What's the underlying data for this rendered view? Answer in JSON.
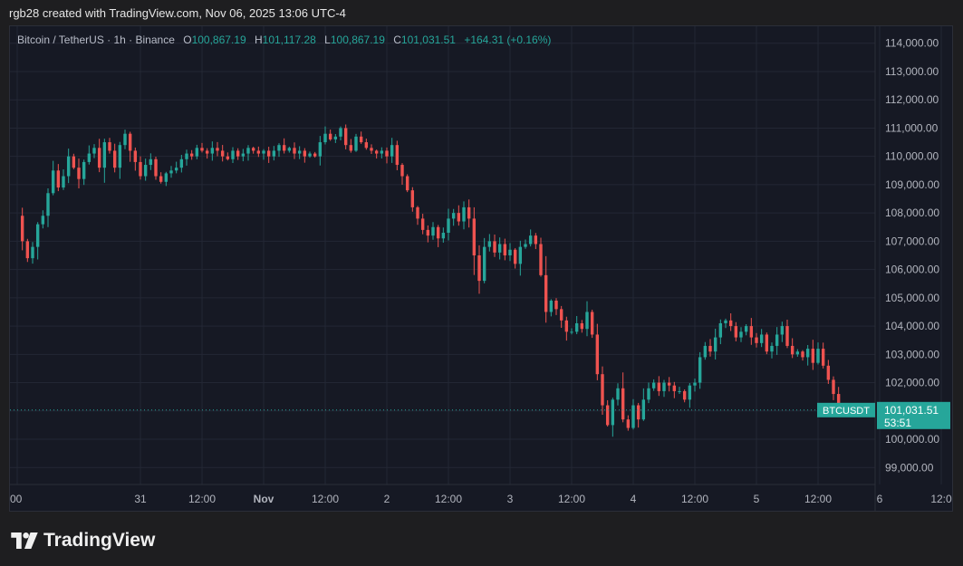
{
  "header": {
    "credit": "rgb28 created with TradingView.com, Nov 06, 2025 13:06 UTC-4"
  },
  "legend": {
    "symbol": "Bitcoin / TetherUS · 1h · Binance",
    "o_key": "O",
    "o_val": "100,867.19",
    "h_key": "H",
    "h_val": "101,117.28",
    "l_key": "L",
    "l_val": "100,867.19",
    "c_key": "C",
    "c_val": "101,031.51",
    "change": "+164.31 (+0.16%)"
  },
  "price_tag": {
    "label": "BTCUSDT",
    "price": "101,031.51",
    "countdown": "53:51"
  },
  "footer": {
    "brand": "TradingView"
  },
  "colors": {
    "up": "#26a69a",
    "down": "#ef5350",
    "background": "#161924",
    "grid": "#232734",
    "axis_text": "#b2b5be"
  },
  "chart_data": {
    "type": "candlestick",
    "symbol": "BTCUSDT",
    "interval": "1h",
    "ylim": [
      98400,
      114600
    ],
    "y_ticks": [
      "114,000.00",
      "113,000.00",
      "112,000.00",
      "111,000.00",
      "110,000.00",
      "109,000.00",
      "108,000.00",
      "107,000.00",
      "106,000.00",
      "105,000.00",
      "104,000.00",
      "103,000.00",
      "102,000.00",
      "100,000.00",
      "99,000.00"
    ],
    "y_tick_values": [
      114000,
      113000,
      112000,
      111000,
      110000,
      109000,
      108000,
      107000,
      106000,
      105000,
      104000,
      103000,
      102000,
      100000,
      99000
    ],
    "x_ticks": [
      "00",
      "31",
      "12:00",
      "Nov",
      "12:00",
      "2",
      "12:00",
      "3",
      "12:00",
      "4",
      "12:00",
      "5",
      "12:00",
      "6",
      "12:0"
    ],
    "x_tick_hours": [
      0,
      24,
      36,
      48,
      60,
      72,
      84,
      96,
      108,
      120,
      132,
      144,
      156,
      168,
      180
    ],
    "x_range_hours": [
      0,
      181
    ],
    "last_price": 101031.51,
    "grid": true,
    "anchors": [
      [
        0,
        107900
      ],
      [
        1,
        107000
      ],
      [
        2,
        106400
      ],
      [
        3,
        106800
      ],
      [
        4,
        107600
      ],
      [
        5,
        107900
      ],
      [
        6,
        108700
      ],
      [
        7,
        109500
      ],
      [
        8,
        108900
      ],
      [
        9,
        109300
      ],
      [
        10,
        110000
      ],
      [
        11,
        109600
      ],
      [
        12,
        109200
      ],
      [
        13,
        109800
      ],
      [
        14,
        110100
      ],
      [
        15,
        110300
      ],
      [
        16,
        109600
      ],
      [
        17,
        110500
      ],
      [
        18,
        110200
      ],
      [
        19,
        109600
      ],
      [
        20,
        110400
      ],
      [
        21,
        110800
      ],
      [
        22,
        110200
      ],
      [
        23,
        109800
      ],
      [
        24,
        109300
      ],
      [
        25,
        109700
      ],
      [
        26,
        109900
      ],
      [
        27,
        109300
      ],
      [
        28,
        109100
      ],
      [
        29,
        109400
      ],
      [
        30,
        109500
      ],
      [
        31,
        109600
      ],
      [
        32,
        109900
      ],
      [
        33,
        110100
      ],
      [
        34,
        110000
      ],
      [
        35,
        110300
      ],
      [
        36,
        110200
      ],
      [
        37,
        110100
      ],
      [
        38,
        110300
      ],
      [
        39,
        110200
      ],
      [
        40,
        110000
      ],
      [
        41,
        109900
      ],
      [
        42,
        110200
      ],
      [
        43,
        110000
      ],
      [
        44,
        110100
      ],
      [
        45,
        110300
      ],
      [
        46,
        110200
      ],
      [
        47,
        110100
      ],
      [
        48,
        110200
      ],
      [
        49,
        110000
      ],
      [
        50,
        110200
      ],
      [
        51,
        110400
      ],
      [
        52,
        110200
      ],
      [
        53,
        110300
      ],
      [
        54,
        110100
      ],
      [
        55,
        110200
      ],
      [
        56,
        110000
      ],
      [
        57,
        110100
      ],
      [
        58,
        110000
      ],
      [
        59,
        110500
      ],
      [
        60,
        110800
      ],
      [
        61,
        110600
      ],
      [
        62,
        110700
      ],
      [
        63,
        111000
      ],
      [
        64,
        110400
      ],
      [
        65,
        110200
      ],
      [
        66,
        110700
      ],
      [
        67,
        110500
      ],
      [
        68,
        110300
      ],
      [
        69,
        110200
      ],
      [
        70,
        110100
      ],
      [
        71,
        110200
      ],
      [
        72,
        110000
      ],
      [
        73,
        110400
      ],
      [
        74,
        109700
      ],
      [
        75,
        109300
      ],
      [
        76,
        108800
      ],
      [
        77,
        108200
      ],
      [
        78,
        107800
      ],
      [
        79,
        107400
      ],
      [
        80,
        107200
      ],
      [
        81,
        107500
      ],
      [
        82,
        107100
      ],
      [
        83,
        107300
      ],
      [
        84,
        107800
      ],
      [
        85,
        108000
      ],
      [
        86,
        107700
      ],
      [
        87,
        108200
      ],
      [
        88,
        107800
      ],
      [
        89,
        106500
      ],
      [
        90,
        105600
      ],
      [
        91,
        106800
      ],
      [
        92,
        107000
      ],
      [
        93,
        106600
      ],
      [
        94,
        106900
      ],
      [
        95,
        106500
      ],
      [
        96,
        106700
      ],
      [
        97,
        106200
      ],
      [
        98,
        106800
      ],
      [
        99,
        106900
      ],
      [
        100,
        107200
      ],
      [
        101,
        106900
      ],
      [
        102,
        105800
      ],
      [
        103,
        104500
      ],
      [
        104,
        104900
      ],
      [
        105,
        104600
      ],
      [
        106,
        104200
      ],
      [
        107,
        103800
      ],
      [
        108,
        103800
      ],
      [
        109,
        104100
      ],
      [
        110,
        103900
      ],
      [
        111,
        104500
      ],
      [
        112,
        103700
      ],
      [
        113,
        102300
      ],
      [
        114,
        101200
      ],
      [
        115,
        100500
      ],
      [
        116,
        101400
      ],
      [
        117,
        101800
      ],
      [
        118,
        100700
      ],
      [
        119,
        100400
      ],
      [
        120,
        101200
      ],
      [
        121,
        100700
      ],
      [
        122,
        101400
      ],
      [
        123,
        101800
      ],
      [
        124,
        102000
      ],
      [
        125,
        101700
      ],
      [
        126,
        102000
      ],
      [
        127,
        101900
      ],
      [
        128,
        101700
      ],
      [
        129,
        101700
      ],
      [
        130,
        101400
      ],
      [
        131,
        101900
      ],
      [
        132,
        102000
      ],
      [
        133,
        102900
      ],
      [
        134,
        103300
      ],
      [
        135,
        103100
      ],
      [
        136,
        103600
      ],
      [
        137,
        104100
      ],
      [
        138,
        104200
      ],
      [
        139,
        104000
      ],
      [
        140,
        103600
      ],
      [
        141,
        103800
      ],
      [
        142,
        104000
      ],
      [
        143,
        103600
      ],
      [
        144,
        103400
      ],
      [
        145,
        103700
      ],
      [
        146,
        103100
      ],
      [
        147,
        103300
      ],
      [
        148,
        103700
      ],
      [
        149,
        104000
      ],
      [
        150,
        103300
      ],
      [
        151,
        103000
      ],
      [
        152,
        103100
      ],
      [
        153,
        102900
      ],
      [
        154,
        103200
      ],
      [
        155,
        102700
      ],
      [
        156,
        103200
      ],
      [
        157,
        102600
      ],
      [
        158,
        102100
      ],
      [
        159,
        101600
      ],
      [
        160,
        101031.51
      ]
    ]
  }
}
